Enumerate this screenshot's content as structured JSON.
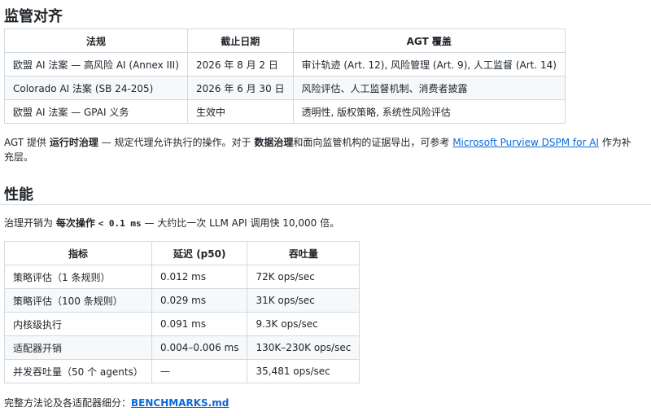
{
  "regulatory": {
    "heading": "监管对齐",
    "headers": [
      "法规",
      "截止日期",
      "AGT 覆盖"
    ],
    "rows": [
      [
        "欧盟 AI 法案 — 高风险 AI (Annex III)",
        "2026 年 8 月 2 日",
        "审计轨迹 (Art. 12), 风险管理 (Art. 9), 人工监督 (Art. 14)"
      ],
      [
        "Colorado AI 法案 (SB 24-205)",
        "2026 年 6 月 30 日",
        "风险评估、人工监督机制、消费者披露"
      ],
      [
        "欧盟 AI 法案 — GPAI 义务",
        "生效中",
        "透明性, 版权策略, 系统性风险评估"
      ]
    ],
    "note_1": "AGT 提供",
    "note_bold_1": "运行时治理",
    "note_2": " — 规定代理允许执行的操作。对于",
    "note_bold_2": "数据治理",
    "note_3": "和面向监管机构的证据导出，可参考",
    "note_link": "Microsoft Purview DSPM for AI",
    "note_4": "作为补",
    "note_5": "充层。"
  },
  "performance": {
    "heading": "性能",
    "intro_1": "治理开销为",
    "intro_bold": "每次操作",
    "intro_code": "< 0.1 ms",
    "intro_2": " — 大约比一次 LLM API 调用快 10,000 倍。",
    "headers": [
      "指标",
      "延迟 (p50)",
      "吞吐量"
    ],
    "rows": [
      [
        "策略评估（1 条规则）",
        "0.012 ms",
        "72K ops/sec"
      ],
      [
        "策略评估（100 条规则）",
        "0.029 ms",
        "31K ops/sec"
      ],
      [
        "内核级执行",
        "0.091 ms",
        "9.3K ops/sec"
      ],
      [
        "适配器开销",
        "0.004–0.006 ms",
        "130K–230K ops/sec"
      ],
      [
        "并发吞吐量（50 个 agents）",
        "—",
        "35,481 ops/sec"
      ]
    ],
    "footer_1": "完整方法论及各适配器细分：",
    "footer_link": "BENCHMARKS.md"
  }
}
